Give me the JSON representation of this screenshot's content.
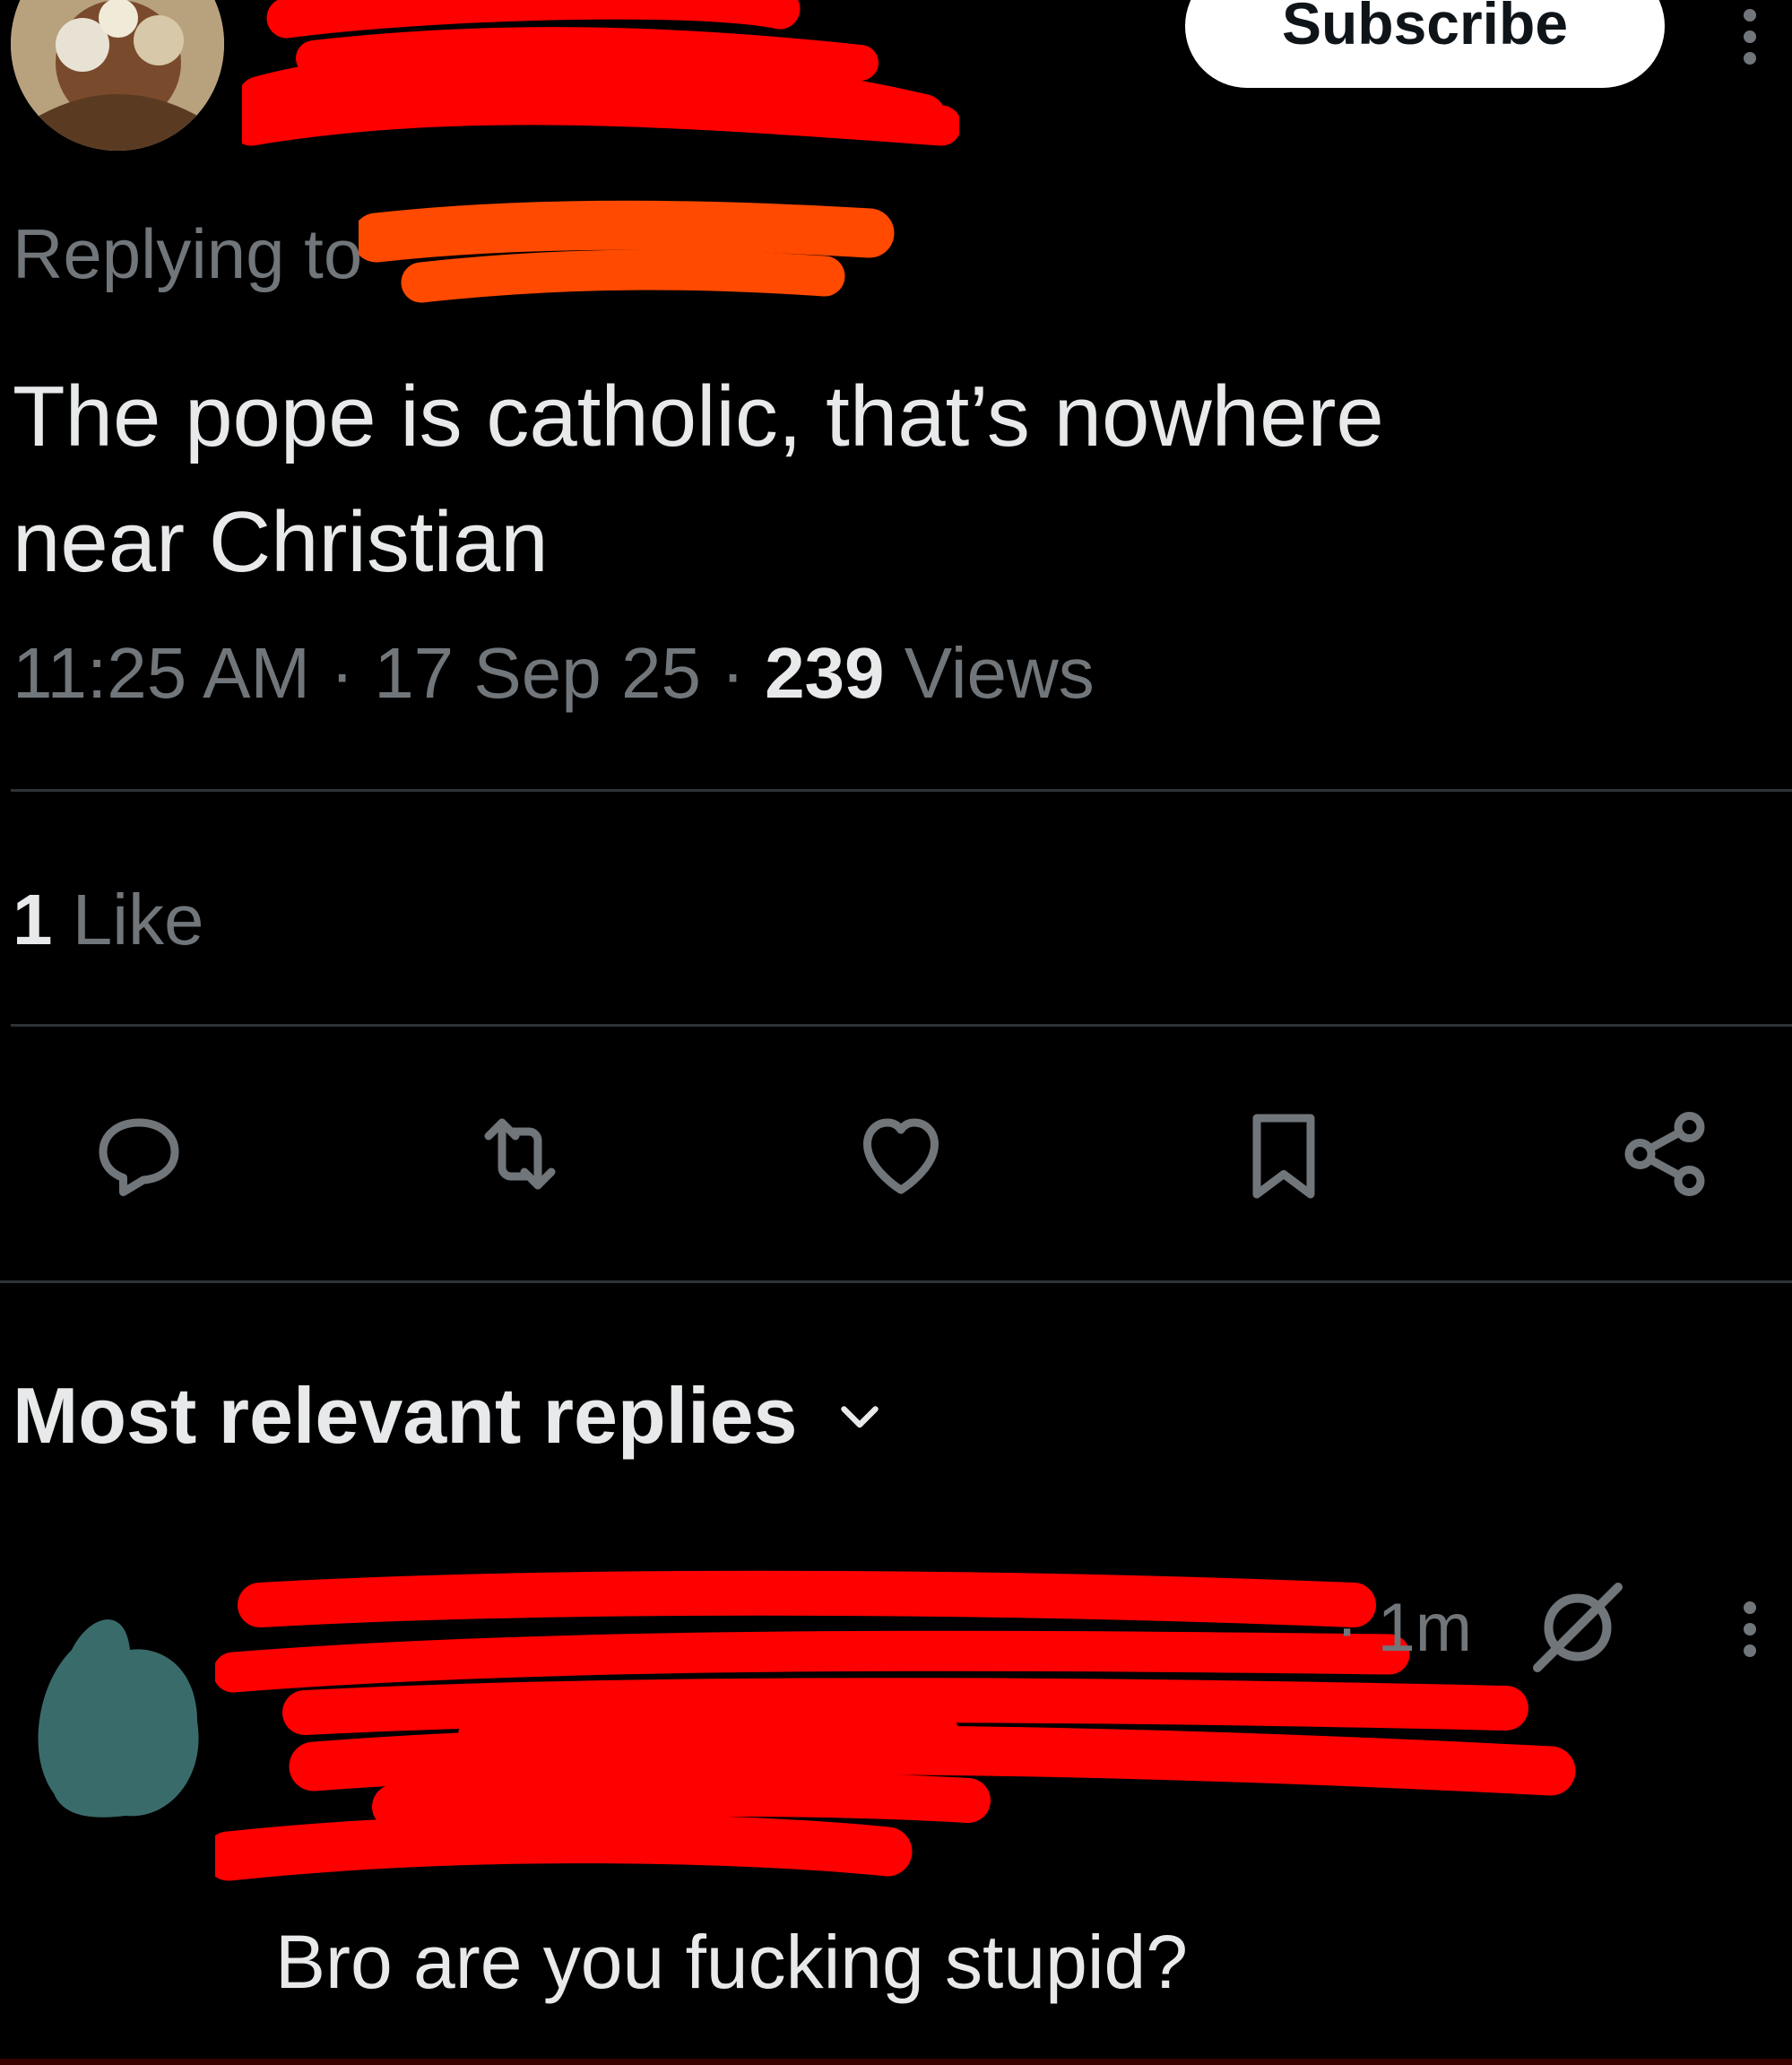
{
  "header": {
    "subscribe_label": "Subscribe",
    "more_icon": "more-vertical-icon"
  },
  "tweet": {
    "replying_prefix": "Replying to",
    "text_line1": "The pope is catholic, that’s nowhere",
    "text_line2": "near Christian",
    "time": "11:25 AM",
    "date": "17 Sep 25",
    "views_count": "239",
    "views_label": "Views",
    "likes_count": "1",
    "likes_label": "Like"
  },
  "actions": {
    "reply_icon": "reply-icon",
    "repost_icon": "repost-icon",
    "like_icon": "heart-icon",
    "bookmark_icon": "bookmark-icon",
    "share_icon": "share-icon"
  },
  "replies": {
    "section_title": "Most relevant replies",
    "items": [
      {
        "time": "1m",
        "text": "Bro are you fucking stupid?"
      }
    ]
  },
  "colors": {
    "background": "#000000",
    "primary_text": "#e7e9ea",
    "secondary_text": "#71767b",
    "divider": "#2f3336",
    "redaction_red": "#ff0000",
    "redaction_orange": "#ff4a00",
    "reply_avatar": "#3a6b6b"
  }
}
